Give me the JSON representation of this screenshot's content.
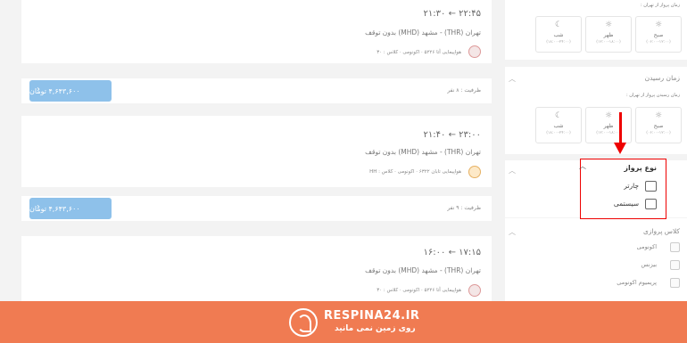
{
  "flights": [
    {
      "time_text": "۲۱:۳۰ ← ۲۲:۴۵",
      "route": "تهران (THR) - مشهد (MHD)   بدون توقف",
      "airline": "هواپیمایی آتا ۵۲۲۶ · اکونومی · کلاس : ۳۰",
      "capacity": "ظرفیت : ۸ نفر",
      "price": "۴,۶۴۳,۶۰۰ تومان"
    },
    {
      "time_text": "۲۱:۴۰ ← ۲۳:۰۰",
      "route": "تهران (THR) - مشهد (MHD)   بدون توقف",
      "airline": "هواپیمایی تابان ۶۳۲۲ · اکونومی · کلاس : HH",
      "capacity": "ظرفیت : ۹ نفر",
      "price": "۴,۶۴۳,۶۰۰ تومان"
    },
    {
      "time_text": "۱۶:۰۰ ← ۱۷:۱۵",
      "route": "تهران (THR) - مشهد (MHD)   بدون توقف",
      "airline": "هواپیمایی آتا ۵۲۲۶ · اکونومی · کلاس : ۳۰"
    }
  ],
  "sidebar": {
    "departure_sub": "زمان پرواز از تهران :",
    "arrival_title": "زمان رسیدن",
    "arrival_sub": "زمان رسیدن پرواز از تهران :",
    "tiles": [
      {
        "name": "شب",
        "range": "(۱۸:۰۰-۲۴:۰۰)",
        "icon": "☾"
      },
      {
        "name": "ظهر",
        "range": "(۱۲:۰۰-۱۸:۰۰)",
        "icon": "☼"
      },
      {
        "name": "صبح",
        "range": "(۰۶:۰۰-۱۲:۰۰)",
        "icon": "☼"
      }
    ],
    "flight_type_title": "نوع پرواز",
    "flight_type_options": [
      "چارتر",
      "سیستمی"
    ],
    "class_title": "کلاس پروازی",
    "class_options": [
      "اکونومی",
      "بیزنس",
      "پریمیوم اکونومی"
    ]
  },
  "banner": {
    "brand": "RESPINA24.IR",
    "tagline": "روی زمین نمی مانید"
  },
  "colors": {
    "price_button": "#8ec1ea",
    "highlight": "#ee0000",
    "banner": "#f07b52"
  }
}
